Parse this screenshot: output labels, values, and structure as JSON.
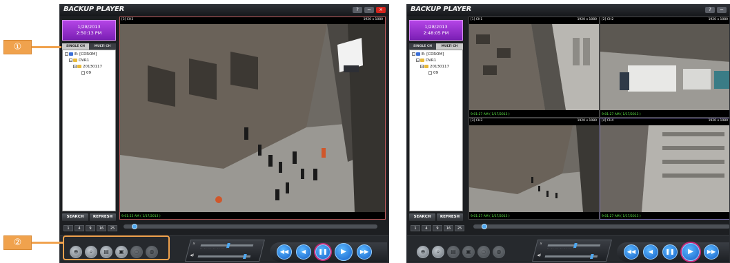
{
  "callouts": {
    "one": "①",
    "two": "②"
  },
  "players": [
    {
      "title": "BACKUP PLAYER",
      "window_buttons": [
        "?",
        "−",
        "×"
      ],
      "date": "1/28/2013",
      "time": "2:50:13 PM",
      "tabs": [
        "SINGLE CH",
        "MULTI CH"
      ],
      "active_tab": "SINGLE CH",
      "tree": [
        "E: [CDROM]",
        "DVR1",
        "20130117",
        "09"
      ],
      "search_label": "SEARCH",
      "refresh_label": "REFRESH",
      "split_buttons": [
        "1",
        "4",
        "9",
        "16",
        "25"
      ],
      "cameras": [
        {
          "channel": "[3] CH3",
          "resolution": "1920 x 1080",
          "timestamp": "9:01:55 AM ( 1/17/2013 )"
        }
      ],
      "playback_buttons": [
        "◀◀",
        "◀",
        "❚❚",
        "▶",
        "▶▶"
      ],
      "active_playback": "❚❚"
    },
    {
      "title": "BACKUP PLAYER",
      "window_buttons": [
        "?",
        "−",
        "×"
      ],
      "date": "1/28/2013",
      "time": "2:48:05 PM",
      "tabs": [
        "SINGLE CH",
        "MULTI CH"
      ],
      "active_tab": "MULTI CH",
      "tree": [
        "E: [CDROM]",
        "DVR1",
        "20130117",
        "09"
      ],
      "search_label": "SEARCH",
      "refresh_label": "REFRESH",
      "split_buttons": [
        "1",
        "4",
        "9",
        "16",
        "25"
      ],
      "cameras": [
        {
          "channel": "[1] CH1",
          "resolution": "1920 x 1080",
          "timestamp": "9:01:27 AM ( 1/17/2013 )"
        },
        {
          "channel": "[2] CH2",
          "resolution": "1920 x 1080",
          "timestamp": "9:01:27 AM ( 1/17/2013 )"
        },
        {
          "channel": "[3] CH3",
          "resolution": "1920 x 1080",
          "timestamp": "9:01:27 AM ( 1/17/2013 )"
        },
        {
          "channel": "[4] CH4",
          "resolution": "1920 x 1080",
          "timestamp": "9:01:27 AM ( 1/17/2013 )"
        }
      ],
      "playback_buttons": [
        "◀◀",
        "◀",
        "❚❚",
        "▶",
        "▶▶"
      ],
      "active_playback": "▶"
    }
  ],
  "tool_icons": [
    "zoom-in-icon",
    "search-icon",
    "print-icon",
    "save-icon",
    "audio-icon",
    "snapshot-icon"
  ],
  "colors": {
    "date_bg": "#9b33d6",
    "accent_blue": "#1f7fe0",
    "timestamp_green": "#5ef046",
    "callout": "#f0a24d",
    "close": "#d3241c"
  }
}
